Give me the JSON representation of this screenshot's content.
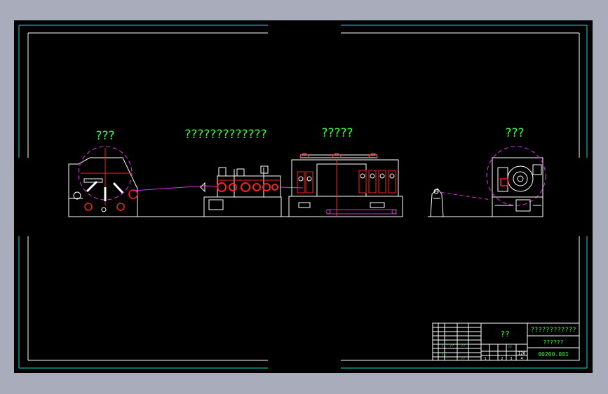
{
  "drawing": {
    "labels": {
      "uncoiler": "???",
      "forming_section": "?????????????",
      "welding_section": "?????",
      "cutoff_section": "???"
    },
    "title_block": {
      "name": "??",
      "company": "????????????",
      "subtitle": "??????",
      "drawing_no": "00200.001",
      "scale": "120",
      "sheet_marks": [
        "1",
        "2",
        "3",
        "4"
      ],
      "small_marks": [
        "??",
        "??",
        "??",
        "??",
        "??",
        "??"
      ]
    }
  },
  "colors": {
    "background": "#000000",
    "frame": "#22d3d3",
    "linework": "#ffffff",
    "text": "#33ff33",
    "red": "#ff2020",
    "magenta": "#e030e0"
  }
}
